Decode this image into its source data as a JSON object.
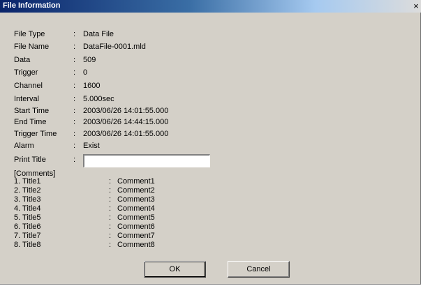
{
  "window": {
    "title": "File Information",
    "close_glyph": "×"
  },
  "fields": [
    {
      "label": "File Type",
      "colon": ":",
      "value": "Data File"
    },
    {
      "label": "File Name",
      "colon": ":",
      "value": "DataFile-0001.mld"
    },
    {
      "label": "Data",
      "colon": ":",
      "value": "509"
    },
    {
      "label": "Trigger",
      "colon": ":",
      "value": "0"
    },
    {
      "label": "Channel",
      "colon": ":",
      "value": "1600"
    },
    {
      "label": "Interval",
      "colon": ":",
      "value": "5.000sec"
    },
    {
      "label": "Start Time",
      "colon": ":",
      "value": "2003/06/26 14:01:55.000"
    },
    {
      "label": "End Time",
      "colon": ":",
      "value": "2003/06/26 14:44:15.000"
    },
    {
      "label": "Trigger Time",
      "colon": ":",
      "value": "2003/06/26 14:01:55.000"
    },
    {
      "label": "Alarm",
      "colon": ":",
      "value": "Exist"
    }
  ],
  "print_title": {
    "label": "Print Title",
    "colon": ":",
    "value": ""
  },
  "comments": {
    "header": "[Comments]",
    "items": [
      {
        "title": "1. Title1",
        "colon": ":",
        "comment": "Comment1"
      },
      {
        "title": "2. Title2",
        "colon": ":",
        "comment": "Comment2"
      },
      {
        "title": "3. Title3",
        "colon": ":",
        "comment": "Comment3"
      },
      {
        "title": "4. Title4",
        "colon": ":",
        "comment": "Comment4"
      },
      {
        "title": "5. Title5",
        "colon": ":",
        "comment": "Comment5"
      },
      {
        "title": "6. Title6",
        "colon": ":",
        "comment": "Comment6"
      },
      {
        "title": "7. Title7",
        "colon": ":",
        "comment": "Comment7"
      },
      {
        "title": "8. Title8",
        "colon": ":",
        "comment": "Comment8"
      }
    ]
  },
  "buttons": {
    "ok": "OK",
    "cancel": "Cancel"
  }
}
